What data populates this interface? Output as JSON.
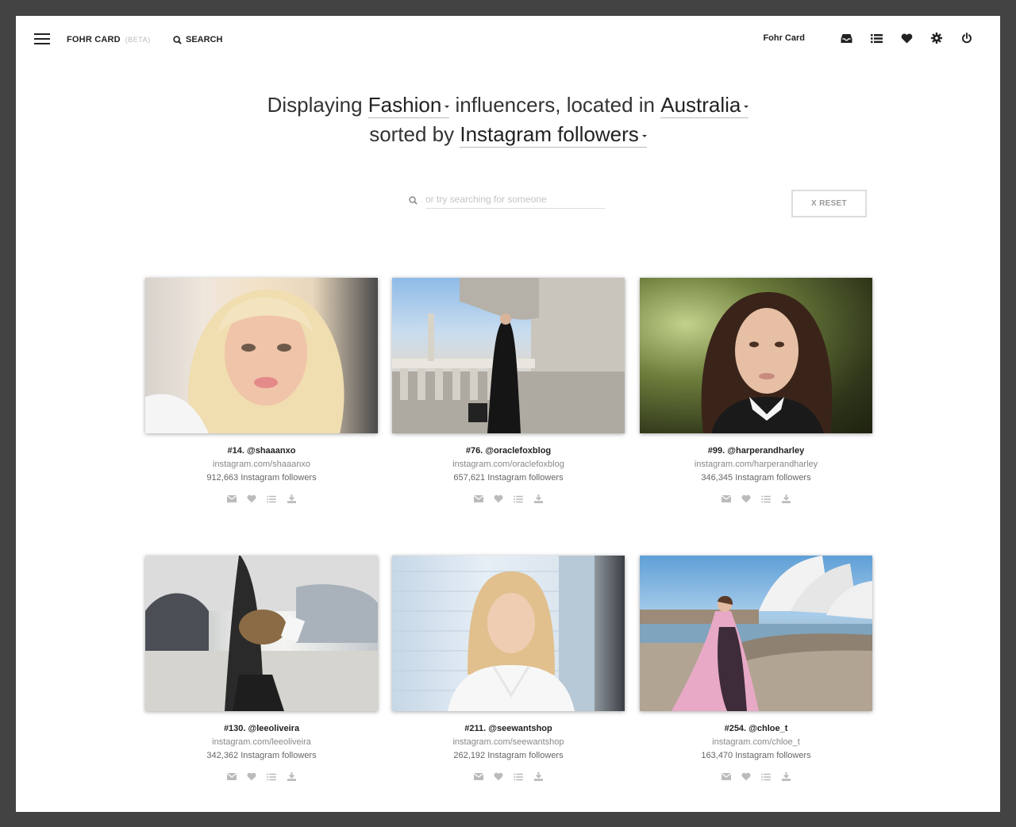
{
  "header": {
    "brand": "FOHR CARD",
    "beta": "(BETA)",
    "search_label": "SEARCH",
    "account_label": "Fohr Card",
    "icons": [
      "inbox-icon",
      "list-icon",
      "heart-icon",
      "gear-icon",
      "power-icon"
    ]
  },
  "headline": {
    "prefix": "Displaying",
    "category": "Fashion",
    "middle": "influencers, located in",
    "location": "Australia",
    "sorted_prefix": "sorted by",
    "sort": "Instagram followers"
  },
  "search": {
    "placeholder": "or try searching for someone",
    "reset_label": "X RESET"
  },
  "influencers": [
    {
      "title": "#14. @shaaanxo",
      "link": "instagram.com/shaaanxo",
      "followers": "912,663 Instagram followers"
    },
    {
      "title": "#76. @oraclefoxblog",
      "link": "instagram.com/oraclefoxblog",
      "followers": "657,621 Instagram followers"
    },
    {
      "title": "#99. @harperandharley",
      "link": "instagram.com/harperandharley",
      "followers": "346,345 Instagram followers"
    },
    {
      "title": "#130. @leeoliveira",
      "link": "instagram.com/leeoliveira",
      "followers": "342,362 Instagram followers"
    },
    {
      "title": "#211. @seewantshop",
      "link": "instagram.com/seewantshop",
      "followers": "262,192 Instagram followers"
    },
    {
      "title": "#254. @chloe_t",
      "link": "instagram.com/chloe_t",
      "followers": "163,470 Instagram followers"
    }
  ],
  "card_actions": [
    "mail-icon",
    "heart-icon",
    "list-icon",
    "download-icon"
  ],
  "colors": {
    "frame": "#434343",
    "text": "#222222",
    "muted": "#888888",
    "action_icon": "#bbbbbb"
  }
}
